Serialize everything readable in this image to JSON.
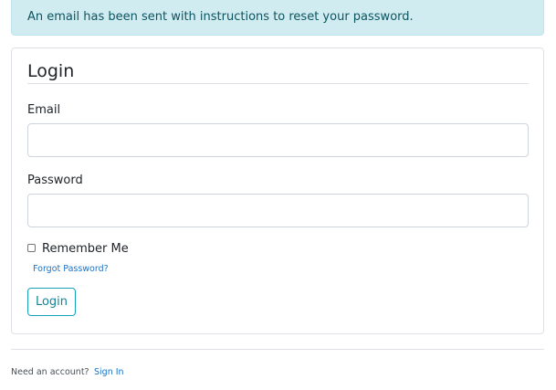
{
  "alert": {
    "message": "An email has been sent with instructions to reset your password.",
    "color": "#0c5460",
    "background": "#d1ecf1"
  },
  "form": {
    "legend": "Login",
    "email": {
      "label": "Email",
      "value": "",
      "placeholder": ""
    },
    "password": {
      "label": "Password",
      "value": "",
      "placeholder": ""
    },
    "remember": {
      "label": "Remember Me",
      "checked": false
    },
    "forgot_link": "Forgot Password?",
    "submit_label": "Login",
    "accent_color": "#17a2b8"
  },
  "footer": {
    "prompt": "Need an account?",
    "link": "Sign In",
    "link_color": "#1a73c8"
  }
}
